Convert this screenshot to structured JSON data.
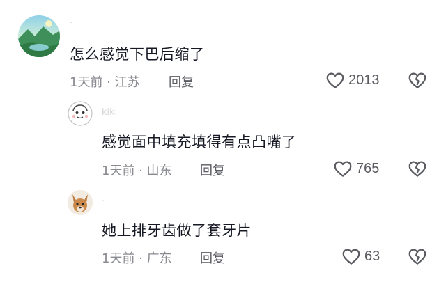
{
  "comments": [
    {
      "username": "·",
      "text": "怎么感觉下巴后缩了",
      "meta": "1天前 · 江苏",
      "reply_label": "回复",
      "likes": "2013"
    },
    {
      "username": "kiki",
      "text": "感觉面中填充填得有点凸嘴了",
      "meta": "1天前 · 山东",
      "reply_label": "回复",
      "likes": "765"
    },
    {
      "username": "·",
      "text": "她上排牙齿做了套牙片",
      "meta": "1天前 · 广东",
      "reply_label": "回复",
      "likes": "63"
    }
  ],
  "icons": {
    "like": "heart-outline-icon",
    "dislike": "broken-heart-icon",
    "avatar_1": "landscape-avatar",
    "avatar_2": "cartoon-avatar",
    "avatar_3": "dog-avatar"
  },
  "colors": {
    "text": "#161823",
    "meta": "#8a8b91",
    "reply": "#5a5b61",
    "icon": "#5a5b61"
  }
}
